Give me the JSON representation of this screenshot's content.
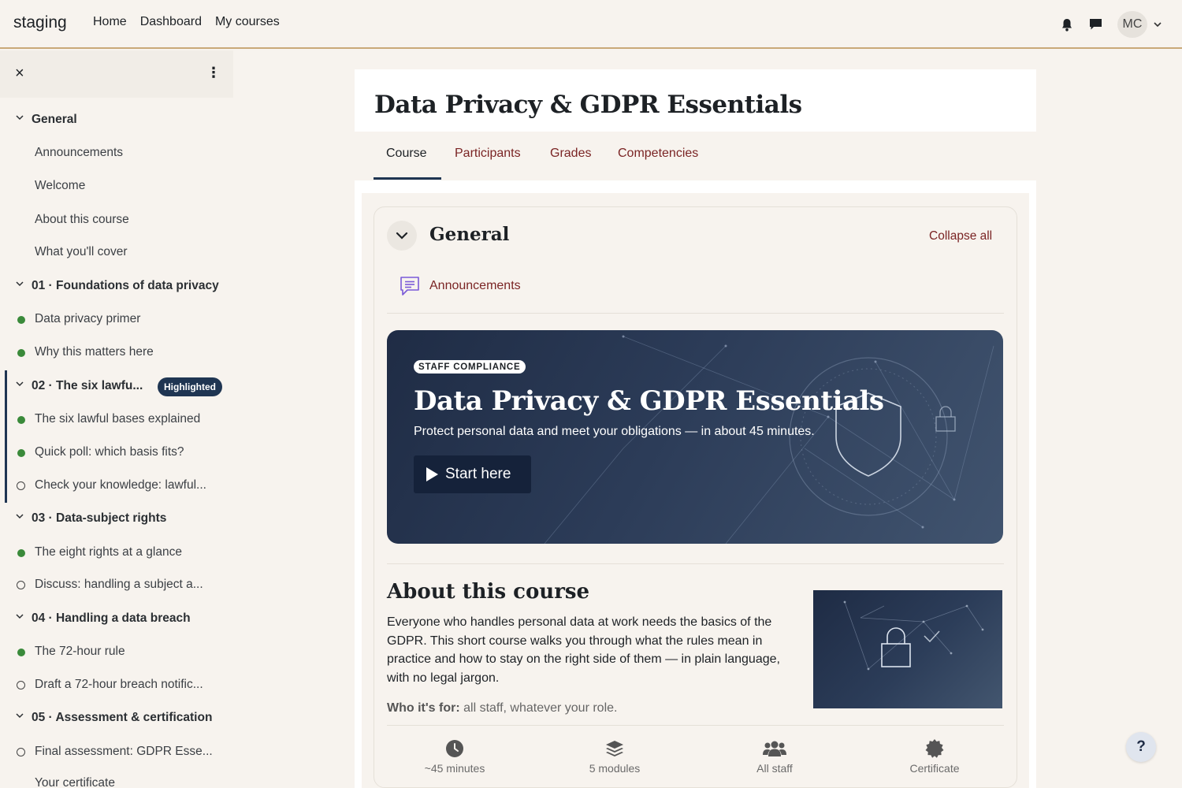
{
  "navbar": {
    "brand": "staging",
    "links": [
      "Home",
      "Dashboard",
      "My courses"
    ],
    "avatar_initials": "MC",
    "icons": [
      "bell-icon",
      "chat-icon",
      "chevron-down-icon"
    ]
  },
  "drawer": {
    "close_glyph": "×",
    "menu_glyph": "⋮",
    "items": [
      {
        "kind": "section",
        "label": "General"
      },
      {
        "kind": "item",
        "label": "Announcements",
        "status": "none"
      },
      {
        "kind": "item",
        "label": "Welcome",
        "status": "none"
      },
      {
        "kind": "item",
        "label": "About this course",
        "status": "none"
      },
      {
        "kind": "item",
        "label": "What you'll cover",
        "status": "none"
      },
      {
        "kind": "section",
        "label": "01 · Foundations of data privacy"
      },
      {
        "kind": "item",
        "label": "Data privacy primer",
        "status": "done"
      },
      {
        "kind": "item",
        "label": "Why this matters here",
        "status": "done"
      },
      {
        "kind": "section",
        "label": "02 · The six lawfu...",
        "badge": "Highlighted"
      },
      {
        "kind": "item",
        "label": "The six lawful bases explained",
        "status": "done"
      },
      {
        "kind": "item",
        "label": "Quick poll: which basis fits?",
        "status": "done"
      },
      {
        "kind": "item",
        "label": "Check your knowledge: lawful...",
        "status": "open"
      },
      {
        "kind": "section",
        "label": "03 · Data-subject rights"
      },
      {
        "kind": "item",
        "label": "The eight rights at a glance",
        "status": "done"
      },
      {
        "kind": "item",
        "label": "Discuss: handling a subject a...",
        "status": "open"
      },
      {
        "kind": "section",
        "label": "04 · Handling a data breach"
      },
      {
        "kind": "item",
        "label": "The 72-hour rule",
        "status": "done"
      },
      {
        "kind": "item",
        "label": "Draft a 72-hour breach notific...",
        "status": "open"
      },
      {
        "kind": "section",
        "label": "05 · Assessment & certification"
      },
      {
        "kind": "item",
        "label": "Final assessment: GDPR Esse...",
        "status": "open"
      },
      {
        "kind": "item",
        "label": "Your certificate",
        "status": "none"
      }
    ]
  },
  "page": {
    "title": "Data Privacy & GDPR Essentials",
    "tabs": [
      "Course",
      "Participants",
      "Grades",
      "Competencies"
    ],
    "active_tab": "Course"
  },
  "section": {
    "title": "General",
    "collapse_all": "Collapse all",
    "announcements_link": "Announcements"
  },
  "hero": {
    "tag": "STAFF COMPLIANCE",
    "title": "Data Privacy & GDPR Essentials",
    "subtitle": "Protect personal data and meet your obligations — in about 45 minutes.",
    "button": "Start here"
  },
  "about": {
    "title": "About this course",
    "body": "Everyone who handles personal data at work needs the basics of the GDPR. This short course walks you through what the rules mean in practice and how to stay on the right side of them — in plain language, with no legal jargon.",
    "who_label": "Who it's for:",
    "who_value": " all staff, whatever your role."
  },
  "stats": [
    {
      "icon": "clock-icon",
      "label": "~45 minutes"
    },
    {
      "icon": "layers-icon",
      "label": "5 modules"
    },
    {
      "icon": "users-icon",
      "label": "All staff"
    },
    {
      "icon": "certificate-icon",
      "label": "Certificate"
    }
  ],
  "help_glyph": "?",
  "colors": {
    "accent_link": "#7a2424",
    "brand_dark": "#1f3552",
    "page_bg": "#f7f3ee",
    "done_dot": "#3a8a3a",
    "nav_border": "#c9a978"
  }
}
